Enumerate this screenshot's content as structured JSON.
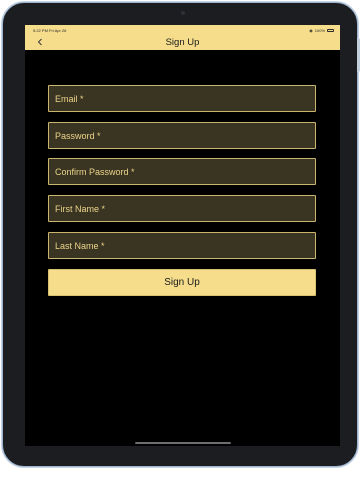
{
  "status_bar": {
    "time": "5:22 PM   Fri Apr 26",
    "battery": "100%"
  },
  "nav": {
    "title": "Sign Up",
    "back_icon": "chevron-left-icon"
  },
  "form": {
    "fields": [
      {
        "label": "Email *"
      },
      {
        "label": "Password *"
      },
      {
        "label": "Confirm Password *"
      },
      {
        "label": "First Name *"
      },
      {
        "label": "Last Name *"
      }
    ],
    "submit_label": "Sign Up"
  },
  "colors": {
    "accent": "#f5dd8b",
    "field_background": "#3a3422",
    "field_border": "#c9b56e",
    "field_text": "#ecd58a",
    "screen_background": "#000000"
  }
}
